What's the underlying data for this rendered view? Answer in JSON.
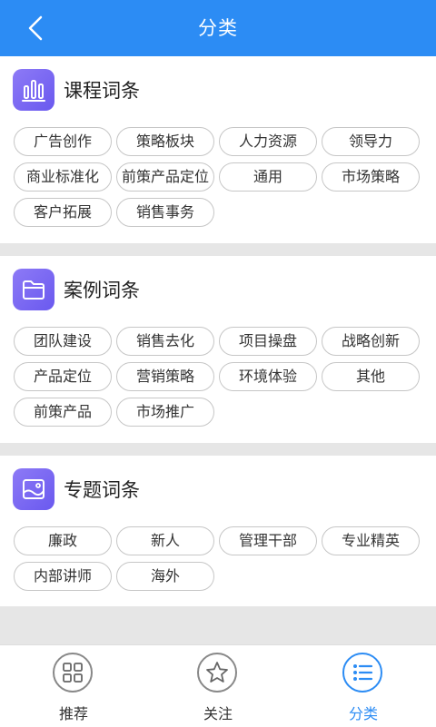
{
  "header": {
    "title": "分类"
  },
  "sections": [
    {
      "title": "课程词条",
      "icon": "bar-chart-icon",
      "tags": [
        "广告创作",
        "策略板块",
        "人力资源",
        "领导力",
        "商业标准化",
        "前策产品定位",
        "通用",
        "市场策略",
        "客户拓展",
        "销售事务"
      ]
    },
    {
      "title": "案例词条",
      "icon": "folder-icon",
      "tags": [
        "团队建设",
        "销售去化",
        "项目操盘",
        "战略创新",
        "产品定位",
        "营销策略",
        "环境体验",
        "其他",
        "前策产品",
        "市场推广"
      ]
    },
    {
      "title": "专题词条",
      "icon": "image-icon",
      "tags": [
        "廉政",
        "新人",
        "管理干部",
        "专业精英",
        "内部讲师",
        "海外"
      ]
    }
  ],
  "bottom_nav": [
    {
      "label": "推荐",
      "icon": "grid-icon",
      "active": false
    },
    {
      "label": "关注",
      "icon": "star-icon",
      "active": false
    },
    {
      "label": "分类",
      "icon": "list-icon",
      "active": true
    }
  ],
  "colors": {
    "primary": "#2c8cf4",
    "section_icon": "#7a68f2"
  }
}
